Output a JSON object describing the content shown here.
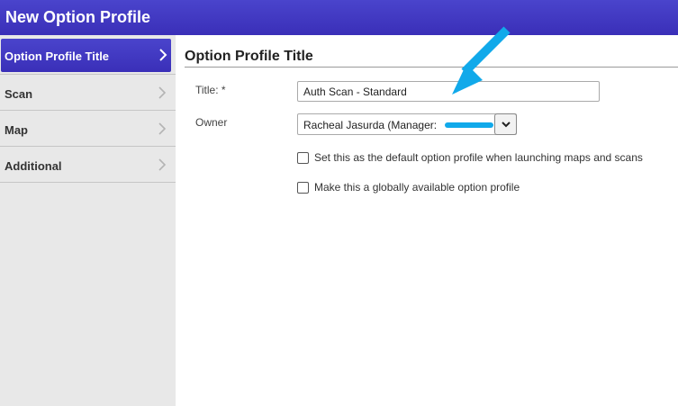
{
  "window": {
    "title": "New Option Profile"
  },
  "sidebar": {
    "items": [
      {
        "label": "Option Profile Title",
        "active": true
      },
      {
        "label": "Scan",
        "active": false
      },
      {
        "label": "Map",
        "active": false
      },
      {
        "label": "Additional",
        "active": false
      }
    ]
  },
  "main": {
    "section_title": "Option Profile Title",
    "title_field": {
      "label": "Title: *",
      "value": "Auth Scan - Standard"
    },
    "owner_field": {
      "label": "Owner",
      "value": "Racheal Jasurda (Manager:"
    },
    "checkboxes": [
      {
        "label": "Set this as the default option profile when launching maps and scans",
        "checked": false
      },
      {
        "label": "Make this a globally available option profile",
        "checked": false
      }
    ]
  },
  "colors": {
    "accent": "#3a2fb8",
    "annotation": "#11a9ea"
  },
  "icons": {
    "nav_chevron": "chevron-right-icon",
    "select_caret": "chevron-down-icon",
    "annotation": "arrow-icon"
  }
}
